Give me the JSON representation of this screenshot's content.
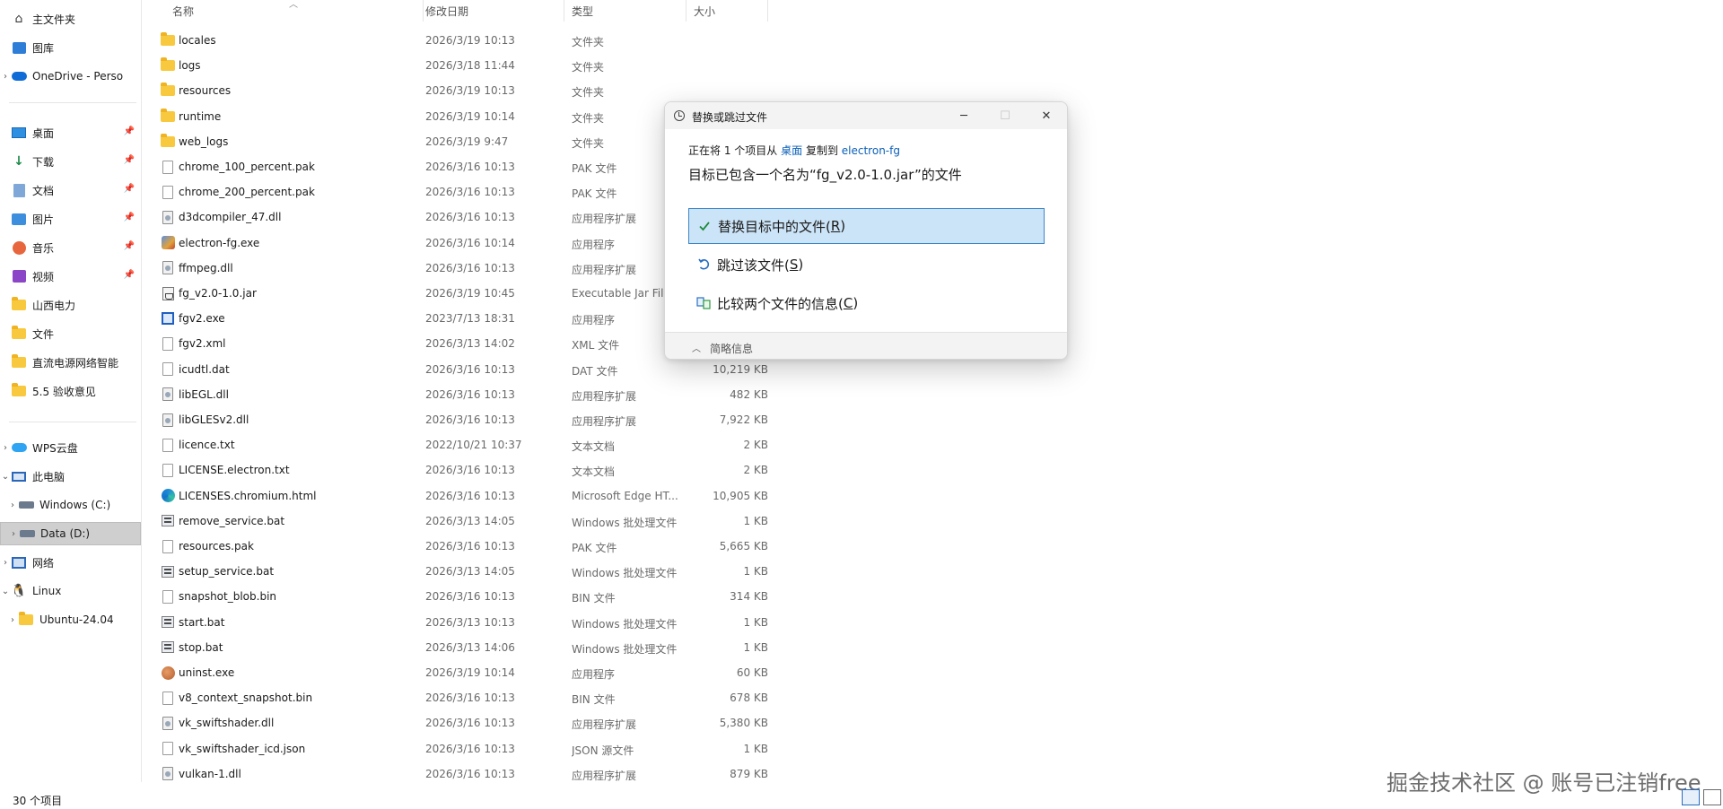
{
  "header": {
    "col_name": "名称",
    "col_date": "修改日期",
    "col_type": "类型",
    "col_size": "大小"
  },
  "sidebar": {
    "items": [
      {
        "label": "主文件夹",
        "icon": "home-icon"
      },
      {
        "label": "图库",
        "icon": "gallery-icon"
      },
      {
        "label": "OneDrive - Perso",
        "icon": "onedrive-cloud-icon",
        "expand": "›"
      },
      {
        "label": "桌面",
        "icon": "desktop-icon",
        "pinned": true
      },
      {
        "label": "下载",
        "icon": "download-icon",
        "pinned": true
      },
      {
        "label": "文档",
        "icon": "documents-icon",
        "pinned": true
      },
      {
        "label": "图片",
        "icon": "pictures-icon",
        "pinned": true
      },
      {
        "label": "音乐",
        "icon": "music-icon",
        "pinned": true
      },
      {
        "label": "视频",
        "icon": "videos-icon",
        "pinned": true
      },
      {
        "label": "山西电力",
        "icon": "folder-icon"
      },
      {
        "label": "文件",
        "icon": "folder-icon"
      },
      {
        "label": "直流电源网络智能",
        "icon": "folder-icon"
      },
      {
        "label": "5.5 验收意见",
        "icon": "folder-icon"
      },
      {
        "label": "WPS云盘",
        "icon": "wps-cloud-icon",
        "expand": "›"
      },
      {
        "label": "此电脑",
        "icon": "this-pc-icon",
        "expand": "⌄"
      },
      {
        "label": "Windows (C:)",
        "icon": "drive-c-icon",
        "expand": "›"
      },
      {
        "label": "Data (D:)",
        "icon": "drive-d-icon",
        "expand": "›"
      },
      {
        "label": "网络",
        "icon": "network-icon",
        "expand": "›"
      },
      {
        "label": "Linux",
        "icon": "linux-icon",
        "expand": "⌄"
      },
      {
        "label": "Ubuntu-24.04",
        "icon": "folder-icon",
        "expand": "›"
      }
    ]
  },
  "files": [
    {
      "name": "locales",
      "date": "2026/3/19 10:13",
      "type": "文件夹",
      "size": "",
      "icon": "folder"
    },
    {
      "name": "logs",
      "date": "2026/3/18 11:44",
      "type": "文件夹",
      "size": "",
      "icon": "folder"
    },
    {
      "name": "resources",
      "date": "2026/3/19 10:13",
      "type": "文件夹",
      "size": "",
      "icon": "folder"
    },
    {
      "name": "runtime",
      "date": "2026/3/19 10:14",
      "type": "文件夹",
      "size": "",
      "icon": "folder"
    },
    {
      "name": "web_logs",
      "date": "2026/3/19 9:47",
      "type": "文件夹",
      "size": "",
      "icon": "folder"
    },
    {
      "name": "chrome_100_percent.pak",
      "date": "2026/3/16 10:13",
      "type": "PAK 文件",
      "size": "",
      "icon": "file"
    },
    {
      "name": "chrome_200_percent.pak",
      "date": "2026/3/16 10:13",
      "type": "PAK 文件",
      "size": "",
      "icon": "file"
    },
    {
      "name": "d3dcompiler_47.dll",
      "date": "2026/3/16 10:13",
      "type": "应用程序扩展",
      "size": "",
      "icon": "dll"
    },
    {
      "name": "electron-fg.exe",
      "date": "2026/3/16 10:14",
      "type": "应用程序",
      "size": "",
      "icon": "exe"
    },
    {
      "name": "ffmpeg.dll",
      "date": "2026/3/16 10:13",
      "type": "应用程序扩展",
      "size": "",
      "icon": "dll"
    },
    {
      "name": "fg_v2.0-1.0.jar",
      "date": "2026/3/19 10:45",
      "type": "Executable Jar File",
      "size": "",
      "icon": "jar"
    },
    {
      "name": "fgv2.exe",
      "date": "2023/7/13 18:31",
      "type": "应用程序",
      "size": "",
      "icon": "exe-blue"
    },
    {
      "name": "fgv2.xml",
      "date": "2026/3/13 14:02",
      "type": "XML 文件",
      "size": "",
      "icon": "file"
    },
    {
      "name": "icudtl.dat",
      "date": "2026/3/16 10:13",
      "type": "DAT 文件",
      "size": "10,219 KB",
      "icon": "file"
    },
    {
      "name": "libEGL.dll",
      "date": "2026/3/16 10:13",
      "type": "应用程序扩展",
      "size": "482 KB",
      "icon": "dll"
    },
    {
      "name": "libGLESv2.dll",
      "date": "2026/3/16 10:13",
      "type": "应用程序扩展",
      "size": "7,922 KB",
      "icon": "dll"
    },
    {
      "name": "licence.txt",
      "date": "2022/10/21 10:37",
      "type": "文本文档",
      "size": "2 KB",
      "icon": "file"
    },
    {
      "name": "LICENSE.electron.txt",
      "date": "2026/3/16 10:13",
      "type": "文本文档",
      "size": "2 KB",
      "icon": "file"
    },
    {
      "name": "LICENSES.chromium.html",
      "date": "2026/3/16 10:13",
      "type": "Microsoft Edge HT...",
      "size": "10,905 KB",
      "icon": "edge"
    },
    {
      "name": "remove_service.bat",
      "date": "2026/3/13 14:05",
      "type": "Windows 批处理文件",
      "size": "1 KB",
      "icon": "bat"
    },
    {
      "name": "resources.pak",
      "date": "2026/3/16 10:13",
      "type": "PAK 文件",
      "size": "5,665 KB",
      "icon": "file"
    },
    {
      "name": "setup_service.bat",
      "date": "2026/3/13 14:05",
      "type": "Windows 批处理文件",
      "size": "1 KB",
      "icon": "bat"
    },
    {
      "name": "snapshot_blob.bin",
      "date": "2026/3/16 10:13",
      "type": "BIN 文件",
      "size": "314 KB",
      "icon": "file"
    },
    {
      "name": "start.bat",
      "date": "2026/3/13 10:13",
      "type": "Windows 批处理文件",
      "size": "1 KB",
      "icon": "bat"
    },
    {
      "name": "stop.bat",
      "date": "2026/3/13 14:06",
      "type": "Windows 批处理文件",
      "size": "1 KB",
      "icon": "bat"
    },
    {
      "name": "uninst.exe",
      "date": "2026/3/19 10:14",
      "type": "应用程序",
      "size": "60 KB",
      "icon": "uninst"
    },
    {
      "name": "v8_context_snapshot.bin",
      "date": "2026/3/16 10:13",
      "type": "BIN 文件",
      "size": "678 KB",
      "icon": "file"
    },
    {
      "name": "vk_swiftshader.dll",
      "date": "2026/3/16 10:13",
      "type": "应用程序扩展",
      "size": "5,380 KB",
      "icon": "dll"
    },
    {
      "name": "vk_swiftshader_icd.json",
      "date": "2026/3/16 10:13",
      "type": "JSON 源文件",
      "size": "1 KB",
      "icon": "file"
    },
    {
      "name": "vulkan-1.dll",
      "date": "2026/3/16 10:13",
      "type": "应用程序扩展",
      "size": "879 KB",
      "icon": "dll"
    }
  ],
  "status": {
    "item_count": "30 个项目"
  },
  "dialog": {
    "title": "替换或跳过文件",
    "line1_prefix": "正在将 1 个项目从",
    "source": "桌面",
    "line1_mid": "复制到",
    "dest": "electron-fg",
    "heading": "目标已包含一个名为“fg_v2.0-1.0.jar”的文件",
    "options": [
      {
        "text": "替换目标中的文件(",
        "key": "R",
        "tail": ")",
        "icon": "checkmark-icon"
      },
      {
        "text": "跳过该文件(",
        "key": "S",
        "tail": ")",
        "icon": "skip-arrow-icon"
      },
      {
        "text": "比较两个文件的信息(",
        "key": "C",
        "tail": ")",
        "icon": "compare-icon"
      }
    ],
    "footer_label": "简略信息",
    "minimize": "─",
    "maximize": "☐",
    "close": "✕"
  },
  "watermark": {
    "text": "掘金技术社区 @ 账号已注销free"
  },
  "colors": {
    "accent": "#0a5fb8",
    "selection": "#cce4f7",
    "selection_border": "#3c86c6",
    "folder": "#f8c93e"
  }
}
